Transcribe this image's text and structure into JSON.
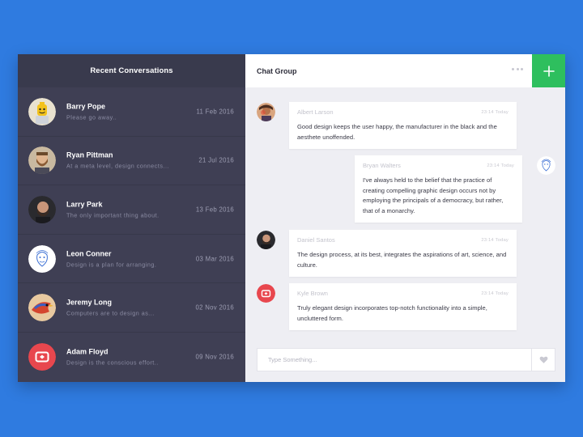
{
  "sidebar": {
    "title": "Recent Conversations",
    "conversations": [
      {
        "name": "Barry Pope",
        "preview": "Please go away..",
        "date": "11 Feb 2016",
        "avatar": "lego-avatar-icon"
      },
      {
        "name": "Ryan Pittman",
        "preview": "At a meta level, design connects...",
        "date": "21 Jul 2016",
        "avatar": "bearded-man-avatar-icon"
      },
      {
        "name": "Larry Park",
        "preview": "The only important thing about.",
        "date": "13 Feb 2016",
        "avatar": "man-dark-avatar-icon"
      },
      {
        "name": "Leon Conner",
        "preview": "Design is a plan for arranging.",
        "date": "03 Mar 2016",
        "avatar": "sketch-face-avatar-icon"
      },
      {
        "name": "Jeremy Long",
        "preview": "Computers are to design as...",
        "date": "02 Nov 2016",
        "avatar": "bird-avatar-icon"
      },
      {
        "name": "Adam Floyd",
        "preview": "Design is the conscious effort..",
        "date": "09 Nov 2016",
        "avatar": "red-logo-avatar-icon"
      }
    ]
  },
  "chat": {
    "title": "Chat Group",
    "add_icon": "plus-icon",
    "more_icon": "more-dots-icon",
    "messages": [
      {
        "author": "Albert Larson",
        "time": "23:14 Today",
        "text": "Good design keeps the user happy, the manufacturer in the black and the aesthete unoffended.",
        "side": "left"
      },
      {
        "author": "Bryan Walters",
        "time": "23:14 Today",
        "text": "I've always held to the belief that the practice of creating compelling graphic design occurs not by employing the principals of a democracy, but rather, that of a monarchy.",
        "side": "right"
      },
      {
        "author": "Daniel Santos",
        "time": "23:14 Today",
        "text": "The design process, at its best, integrates the aspirations of art, science, and culture.",
        "side": "left"
      },
      {
        "author": "Kyle Brown",
        "time": "23:14 Today",
        "text": "Truly elegant design incorporates top-notch functionality into a simple, uncluttered form.",
        "side": "left"
      }
    ],
    "composer": {
      "placeholder": "Type Something...",
      "send_icon": "heart-icon"
    }
  },
  "colors": {
    "background": "#2f7be0",
    "sidebar": "#3f3f54",
    "accent": "#2ebf5e",
    "logo_red": "#e8474e"
  }
}
